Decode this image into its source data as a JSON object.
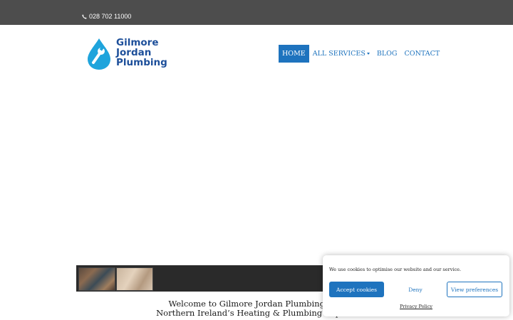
{
  "topbar": {
    "phone": "028 702 11000",
    "phone_icon": "phone-icon",
    "background": "#4d4d4d"
  },
  "logo": {
    "line1": "Gilmore",
    "line2": "Jordan",
    "line3": "Plumbing",
    "icon": "water-drop-wrench-icon",
    "color": "#1d4f9a"
  },
  "nav": {
    "accent": "#1e73be",
    "items": [
      {
        "label": "HOME"
      },
      {
        "label": "ALL SERVICES"
      },
      {
        "label": "BLOG"
      },
      {
        "label": "CONTACT"
      }
    ]
  },
  "welcome": {
    "line1": "Welcome to Gilmore Jordan Plumbing & H",
    "line2": "Northern Ireland’s Heating & Plumbing Experts"
  },
  "cookie": {
    "message": "We use cookies to optimise our website and our service.",
    "accept": "Accept cookies",
    "deny": "Deny",
    "preferences": "View preferences",
    "privacy": "Privacy Policy"
  }
}
